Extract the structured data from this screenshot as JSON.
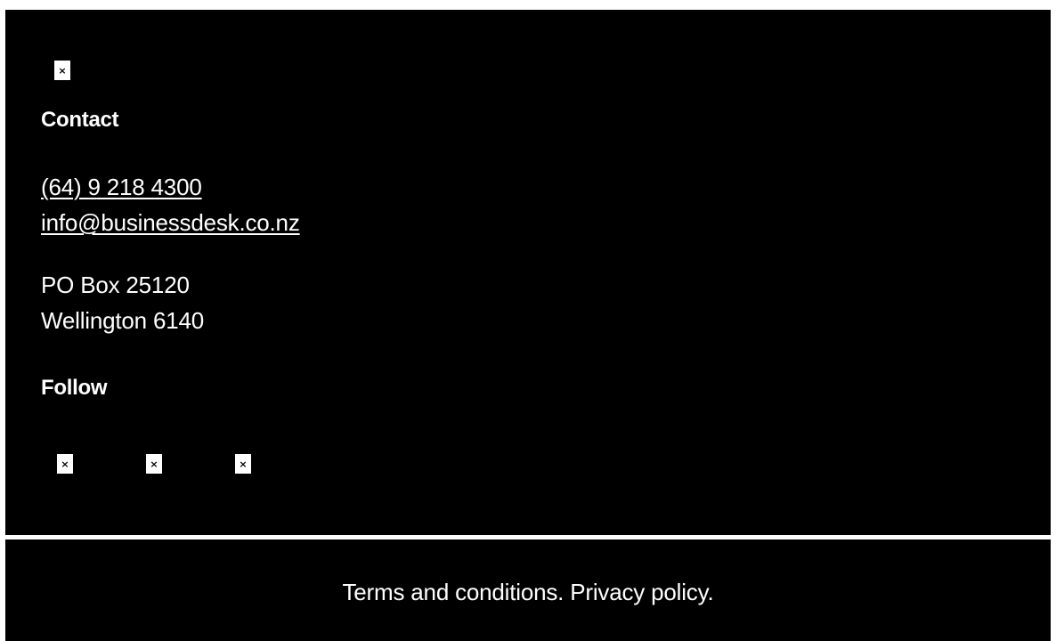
{
  "icons": {
    "broken_image_glyph": "×"
  },
  "contact": {
    "heading": "Contact",
    "phone": "(64) 9 218 4300",
    "email": "info@businessdesk.co.nz",
    "address_line1": "PO Box 25120",
    "address_line2": "Wellington 6140"
  },
  "follow": {
    "heading": "Follow"
  },
  "footer": {
    "terms_label": "Terms and conditions.",
    "privacy_label": "Privacy policy."
  },
  "colors": {
    "background": "#000000",
    "text": "#ffffff",
    "separator": "#ffffff"
  }
}
